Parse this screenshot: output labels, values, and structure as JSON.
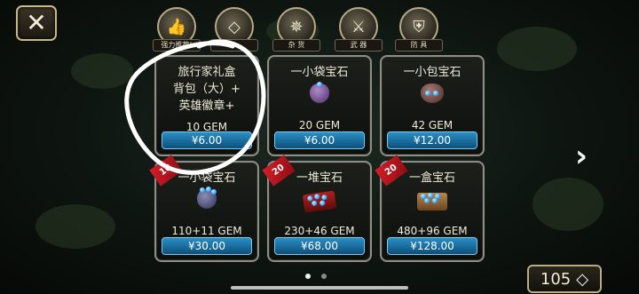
{
  "top_tabs": [
    {
      "label": "强力推荐!",
      "icon": "thumbs-up-icon",
      "glyph": "👍"
    },
    {
      "label": "",
      "icon": "diamond-icon",
      "glyph": "◇"
    },
    {
      "label": "杂 货",
      "icon": "compass-icon",
      "glyph": "✵"
    },
    {
      "label": "武 器",
      "icon": "sword-icon",
      "glyph": "⚔"
    },
    {
      "label": "防 具",
      "icon": "shield-icon",
      "glyph": "⛨"
    }
  ],
  "close_glyph": "✕",
  "cards": [
    {
      "title": "旅行家礼盒",
      "desc1": "背包（大）+",
      "desc2": "英雄徽章+",
      "gem": "10 GEM",
      "price": "¥6.00",
      "ribbon": ""
    },
    {
      "title": "一小袋宝石",
      "gem": "20 GEM",
      "price": "¥6.00",
      "ribbon": ""
    },
    {
      "title": "一小包宝石",
      "gem": "42 GEM",
      "price": "¥12.00",
      "ribbon": ""
    },
    {
      "title": "一小袋宝石",
      "gem": "110+11 GEM",
      "price": "¥30.00",
      "ribbon": "10"
    },
    {
      "title": "一堆宝石",
      "gem": "230+46 GEM",
      "price": "¥68.00",
      "ribbon": "20"
    },
    {
      "title": "一盒宝石",
      "gem": "480+96 GEM",
      "price": "¥128.00",
      "ribbon": "20"
    }
  ],
  "next_glyph": "›",
  "gem_count": "105",
  "gem_glyph": "◇",
  "colors": {
    "price_button": "#1d76ab",
    "annotation": "#ffffff",
    "ribbon": "#d51e28"
  }
}
